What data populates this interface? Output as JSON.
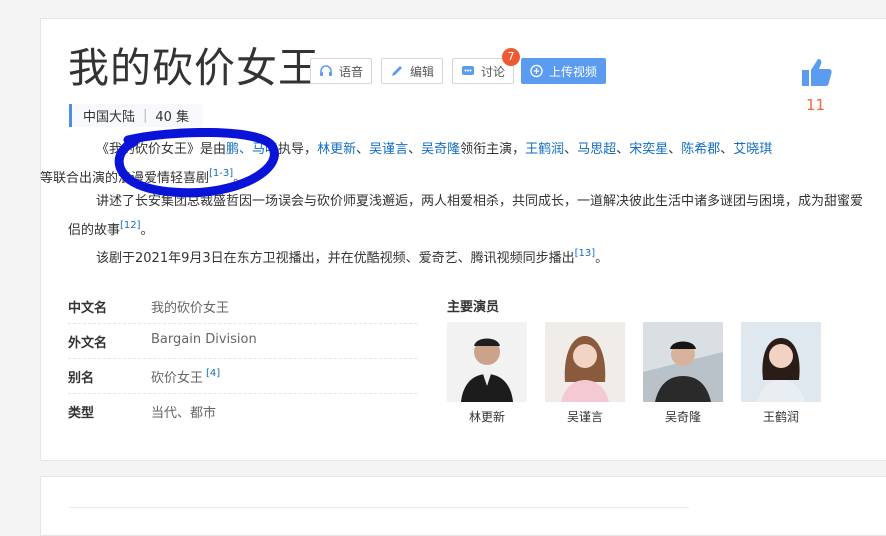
{
  "title": "我的砍价女王",
  "toolbar": {
    "voice": "语音",
    "edit": "编辑",
    "discuss": "讨论",
    "discuss_badge": "7",
    "upload": "上传视频"
  },
  "likes": "11",
  "tags": {
    "region": "中国大陆",
    "episodes": "40 集"
  },
  "summary": {
    "p1": {
      "a": "《我的砍价女王》是由",
      "director_suffix": "鹏、",
      "b": "马鸣",
      "c": "执导，",
      "cast": [
        "林更新",
        "吴谨言",
        "吴奇隆"
      ],
      "d": "领衔主演，",
      "cast2": [
        "王鹤润",
        "马思超",
        "宋奕星",
        "陈希郡",
        "艾晓琪"
      ],
      "e": "等联合出演的浪漫爱情轻喜剧",
      "ref": "[1-3]",
      "end": "。"
    },
    "p2": {
      "text": "讲述了长安集团总裁盛哲因一场误会与砍价师夏浅邂逅，两人相爱相杀，共同成长，一道解决彼此生活中诸多谜团与困境，成为甜蜜爱侣的故事",
      "ref": "[12]",
      "end": "。"
    },
    "p3": {
      "text": "该剧于2021年9月3日在东方卫视播出，并在优酷视频、爱奇艺、腾讯视频同步播出",
      "ref": "[13]",
      "end": "。"
    }
  },
  "info": [
    {
      "key": "中文名",
      "value": "我的砍价女王",
      "ref": ""
    },
    {
      "key": "外文名",
      "value": "Bargain Division",
      "ref": ""
    },
    {
      "key": "别名",
      "value": "砍价女王",
      "ref": "[4]"
    },
    {
      "key": "类型",
      "value": "当代、都市",
      "ref": ""
    }
  ],
  "cast_section": {
    "title": "主要演员",
    "actors": [
      "林更新",
      "吴谨言",
      "吴奇隆",
      "王鹤润"
    ]
  },
  "colors": {
    "link": "#136ec2",
    "accent": "#4a90e2",
    "upload": "#5b9cf0",
    "badge": "#ef5a32",
    "like": "#5b9cf0",
    "scribble": "#0a14d8"
  }
}
